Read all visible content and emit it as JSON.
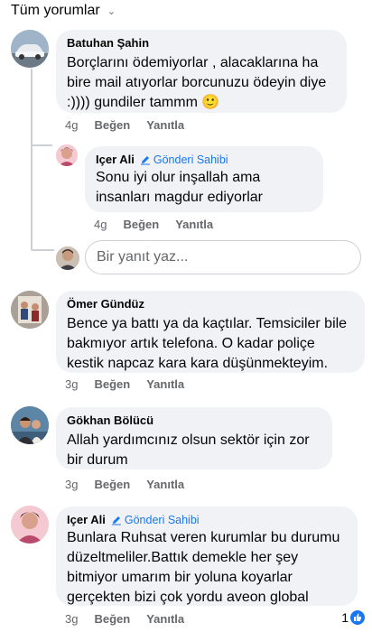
{
  "filter": {
    "label": "Tüm yorumlar"
  },
  "comments": [
    {
      "author": "Batuhan Şahin",
      "text": "Borçlarını ödemiyorlar , alacaklarına ha bire mail atıyorlar borcunuzu ödeyin diye :)))) gundiler tammm 🙂",
      "time": "4g",
      "like": "Beğen",
      "reply": "Yanıtla",
      "replies": [
        {
          "author": "Içer Ali",
          "badge": "Gönderi Sahibi",
          "text": "Sonu iyi olur inşallah  ama insanları magdur  ediyorlar",
          "time": "4g",
          "like": "Beğen",
          "reply": "Yanıtla"
        }
      ]
    },
    {
      "author": "Ömer Gündüz",
      "text": "Bence ya battı ya da kaçtılar. Temsiciler bile bakmıyor artık telefona. O kadar poliçe kestik napcaz kara kara düşünmekteyim.",
      "time": "3g",
      "like": "Beğen",
      "reply": "Yanıtla"
    },
    {
      "author": "Gökhan Bölücü",
      "text": "Allah yardımcınız olsun sektör için zor bir durum",
      "time": "3g",
      "like": "Beğen",
      "reply": "Yanıtla"
    },
    {
      "author": "Içer Ali",
      "badge": "Gönderi Sahibi",
      "text": "Bunlara Ruhsat veren kurumlar bu durumu düzeltmeliler.Battık demekle her şey bitmiyor umarım  bir yoluna  koyarlar gerçekten  bizi çok yordu  aveon global",
      "time": "3g",
      "like": "Beğen",
      "reply": "Yanıtla",
      "reaction_count": "1"
    }
  ],
  "reply_input": {
    "placeholder": "Bir yanıt yaz..."
  },
  "colors": {
    "accent": "#1877f2",
    "bubble": "#f0f2f5",
    "muted": "#65676b"
  }
}
